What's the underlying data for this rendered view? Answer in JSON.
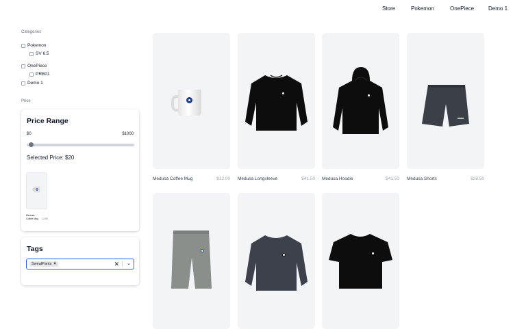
{
  "nav": {
    "links": [
      "Store",
      "Pokemon",
      "OnePiece",
      "Demo 1"
    ]
  },
  "sidebar": {
    "categories_title": "Categories",
    "categories": [
      {
        "label": "Pokemon",
        "sub": [
          "SV 6.5"
        ]
      },
      {
        "label": "OnePiece",
        "sub": [
          "PRB01"
        ]
      },
      {
        "label": "Demo 1",
        "sub": []
      }
    ],
    "price_title": "Price",
    "price_range": {
      "heading": "Price Range",
      "min_label": "$0",
      "max_label": "$1000",
      "selected_value": 20,
      "selected_label": "Selected Price: $20",
      "mini_product_name": "Medusa Coffee Mug",
      "mini_product_price": "12.00"
    },
    "tags": {
      "heading": "Tags",
      "selected": [
        "SweatPants"
      ],
      "clear_glyph": "✕",
      "chevron_glyph": "⌄"
    }
  },
  "products": [
    {
      "name": "Medusa Coffee Mug",
      "price": "$12.00"
    },
    {
      "name": "Medusa Longsleeve",
      "price": "$41.50"
    },
    {
      "name": "Medusa Hoodie",
      "price": "$41.50"
    },
    {
      "name": "Medusa Shorts",
      "price": "$28.50"
    },
    {
      "name": "",
      "price": ""
    },
    {
      "name": "",
      "price": ""
    },
    {
      "name": "",
      "price": ""
    }
  ],
  "colors": {
    "accent": "#2563eb",
    "image_bg": "#f3f4f6",
    "garment_black": "#0d0d0d",
    "shorts": "#3b3f47",
    "sweatpants": "#8a8f8c",
    "sweatshirt": "#3c414b"
  }
}
